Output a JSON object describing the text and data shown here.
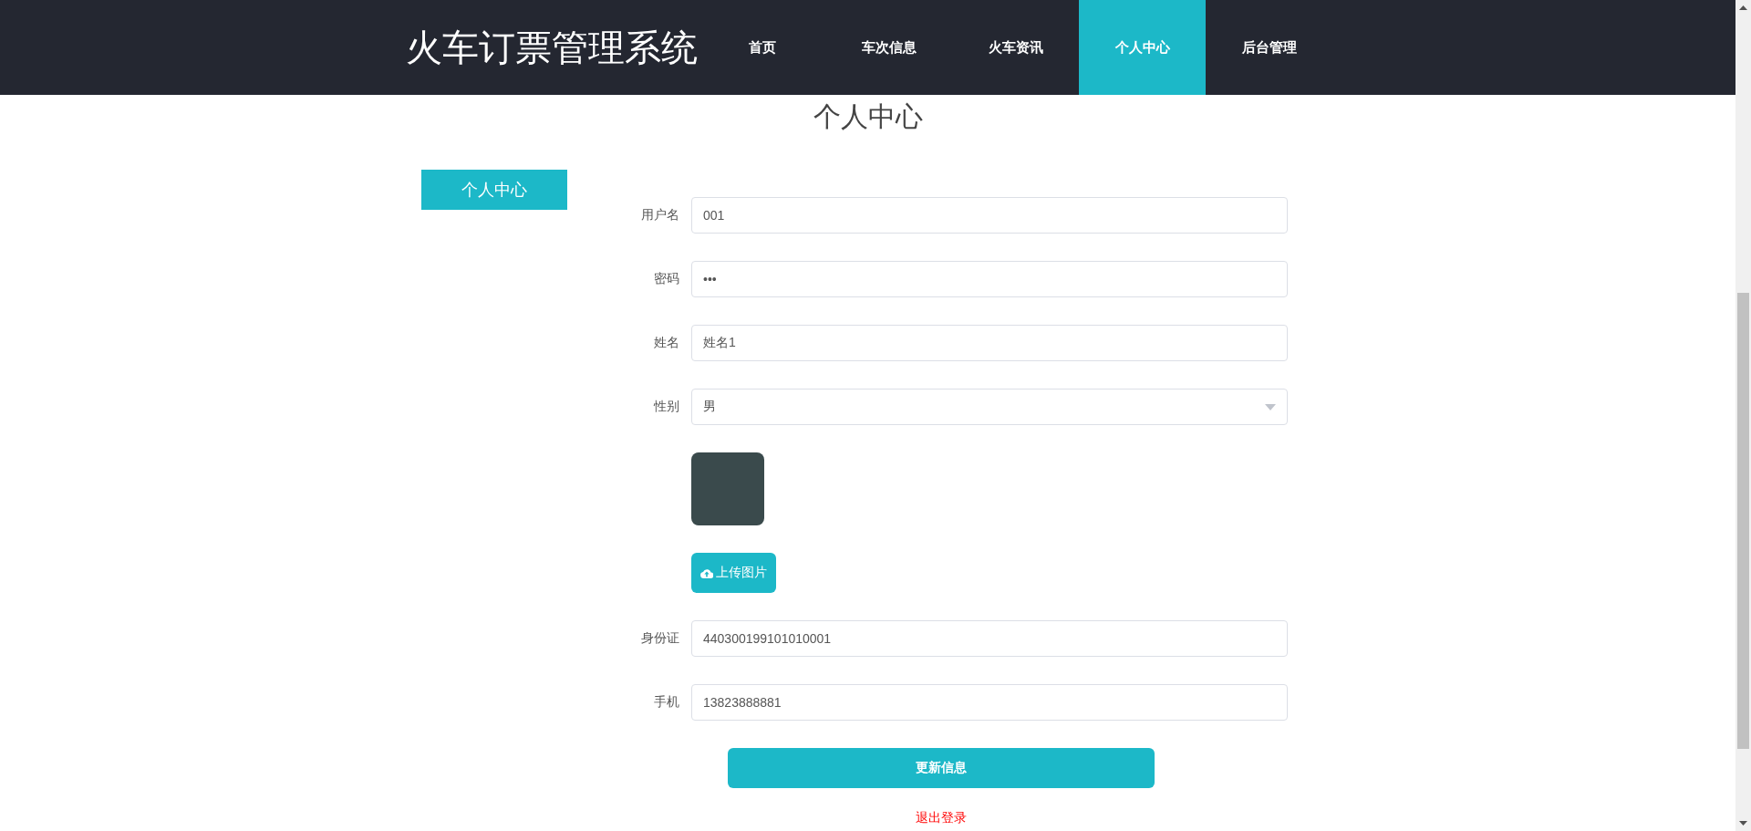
{
  "header": {
    "logo": "火车订票管理系统",
    "nav": [
      {
        "label": "首页",
        "selected": false
      },
      {
        "label": "车次信息",
        "selected": false
      },
      {
        "label": "火车资讯",
        "selected": false
      },
      {
        "label": "个人中心",
        "selected": true
      },
      {
        "label": "后台管理",
        "selected": false
      }
    ]
  },
  "page_title": "个人中心",
  "sidebar": {
    "items": [
      {
        "label": "个人中心",
        "selected": true
      }
    ]
  },
  "form": {
    "fields": [
      {
        "kind": "input",
        "label": "用户名",
        "value": "001"
      },
      {
        "kind": "input",
        "label": "密码",
        "value": "•••"
      },
      {
        "kind": "input",
        "label": "姓名",
        "value": "姓名1"
      },
      {
        "kind": "select",
        "label": "性别",
        "value": "男"
      },
      {
        "kind": "photo"
      },
      {
        "kind": "upload",
        "button": "上传图片"
      },
      {
        "kind": "input",
        "label": "身份证",
        "value": "440300199101010001"
      },
      {
        "kind": "input",
        "label": "手机",
        "value": "13823888881"
      }
    ],
    "submit": "更新信息",
    "logout": "退出登录"
  }
}
